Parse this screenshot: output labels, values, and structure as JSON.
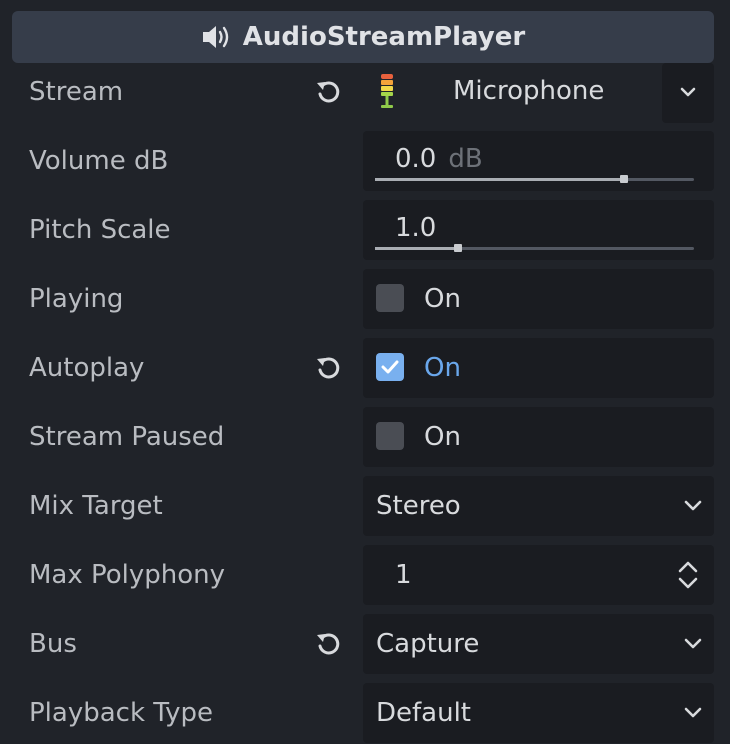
{
  "header": {
    "title": "AudioStreamPlayer",
    "icon": "speaker-icon"
  },
  "properties": {
    "stream": {
      "label": "Stream",
      "value": "Microphone"
    },
    "volume_db": {
      "label": "Volume dB",
      "value": "0.0",
      "unit": "dB",
      "slider_fraction": 0.78
    },
    "pitch_scale": {
      "label": "Pitch Scale",
      "value": "1.0",
      "slider_fraction": 0.26
    },
    "playing": {
      "label": "Playing",
      "checked": false,
      "check_label": "On"
    },
    "autoplay": {
      "label": "Autoplay",
      "checked": true,
      "check_label": "On"
    },
    "stream_paused": {
      "label": "Stream Paused",
      "checked": false,
      "check_label": "On"
    },
    "mix_target": {
      "label": "Mix Target",
      "value": "Stereo"
    },
    "max_polyphony": {
      "label": "Max Polyphony",
      "value": "1"
    },
    "bus": {
      "label": "Bus",
      "value": "Capture"
    },
    "playback_type": {
      "label": "Playback Type",
      "value": "Default"
    }
  },
  "colors": {
    "background": "#202329",
    "header": "#363d4a",
    "field": "#1a1c21",
    "accent": "#6aa7ec"
  }
}
